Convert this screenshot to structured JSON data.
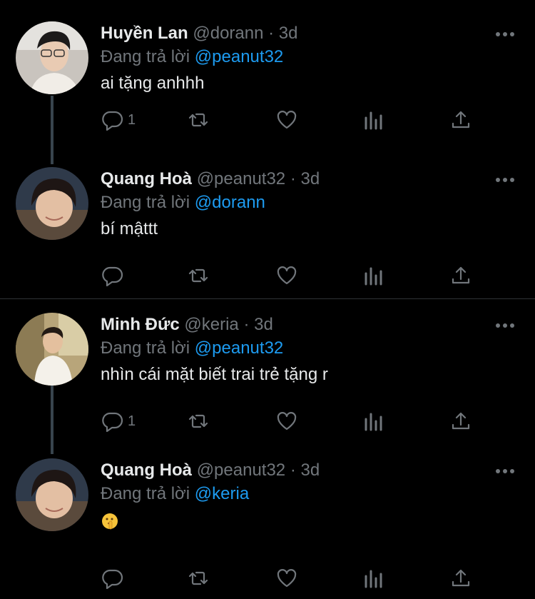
{
  "colors": {
    "background": "#000000",
    "text": "#e7e9ea",
    "muted": "#71767b",
    "mention": "#1d9bf0",
    "line": "#38444d"
  },
  "reply_prefix": "Đang trả lời",
  "tweets": [
    {
      "name": "Huyền Lan",
      "handle": "@dorann",
      "time": "· 3d",
      "reply_to": "@peanut32",
      "text": "ai tặng anhhh",
      "reply_count": "1",
      "avatar_icon": "avatar-huyen-lan"
    },
    {
      "name": "Quang Hoà",
      "handle": "@peanut32",
      "time": "· 3d",
      "reply_to": "@dorann",
      "text": "bí mậttt",
      "reply_count": "",
      "avatar_icon": "avatar-quang-hoa"
    },
    {
      "name": "Minh Đức",
      "handle": "@keria",
      "time": "· 3d",
      "reply_to": "@peanut32",
      "text": "nhìn cái mặt biết trai trẻ tặng r",
      "reply_count": "1",
      "avatar_icon": "avatar-minh-duc"
    },
    {
      "name": "Quang Hoà",
      "handle": "@peanut32",
      "time": "· 3d",
      "reply_to": "@keria",
      "text": "",
      "emoji": "shushing-face-emoji",
      "reply_count": "",
      "avatar_icon": "avatar-quang-hoa"
    }
  ],
  "action_icons": [
    "reply-icon",
    "retweet-icon",
    "like-icon",
    "analytics-icon",
    "share-icon",
    "more-icon"
  ]
}
